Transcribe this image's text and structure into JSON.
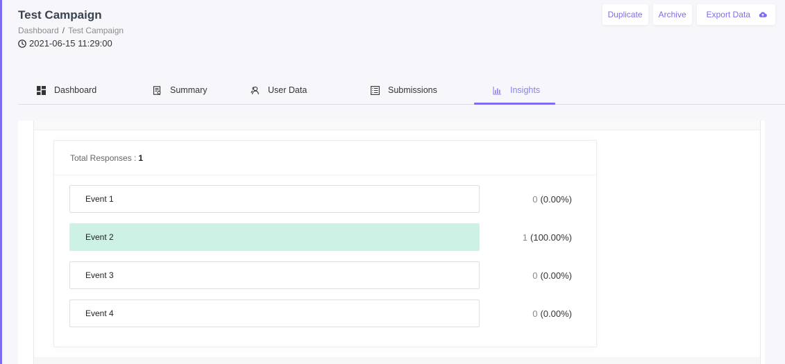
{
  "header": {
    "title": "Test Campaign",
    "breadcrumb": [
      "Dashboard",
      "Test Campaign"
    ],
    "breadcrumb_separator": "/",
    "timestamp": "2021-06-15 11:29:00",
    "timestamp_icon": "clock-icon"
  },
  "actions": {
    "duplicate_label": "Duplicate",
    "archive_label": "Archive",
    "export_label": "Export Data",
    "export_icon": "cloud-upload-icon"
  },
  "tabs": [
    {
      "label": "Dashboard",
      "icon": "dashboard-grid-icon",
      "active": false
    },
    {
      "label": "Summary",
      "icon": "summary-doc-icon",
      "active": false
    },
    {
      "label": "User Data",
      "icon": "users-icon",
      "active": false
    },
    {
      "label": "Submissions",
      "icon": "list-icon",
      "active": false
    },
    {
      "label": "Insights",
      "icon": "bar-chart-icon",
      "active": true
    }
  ],
  "insights": {
    "total_label": "Total Responses :",
    "total_value": "1",
    "events": [
      {
        "label": "Event 1",
        "count": "0",
        "percent": "(0.00%)",
        "selected": false
      },
      {
        "label": "Event 2",
        "count": "1",
        "percent": "(100.00%)",
        "selected": true
      },
      {
        "label": "Event 3",
        "count": "0",
        "percent": "(0.00%)",
        "selected": false
      },
      {
        "label": "Event 4",
        "count": "0",
        "percent": "(0.00%)",
        "selected": false
      }
    ]
  },
  "colors": {
    "accent": "#7b6cf0",
    "selected_row": "#cdf2e5"
  }
}
